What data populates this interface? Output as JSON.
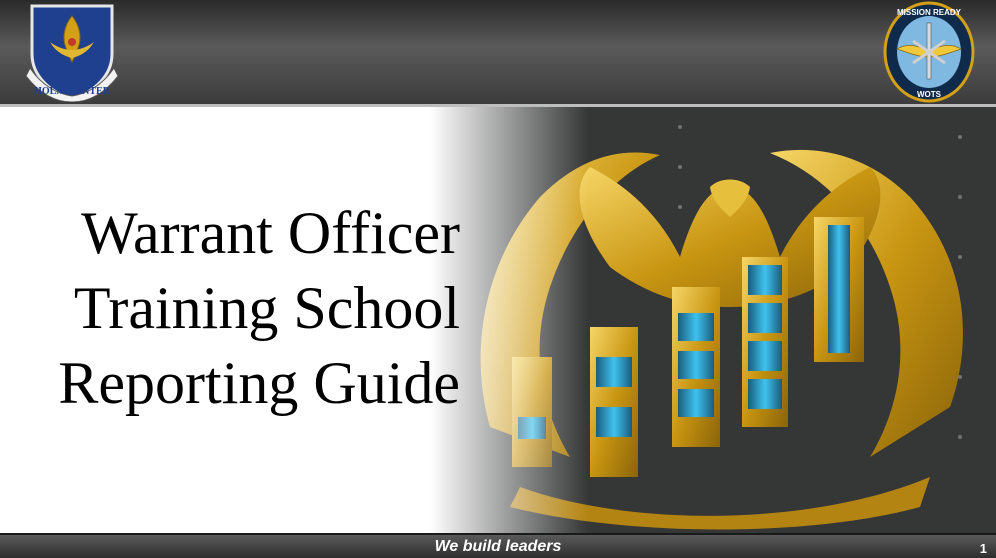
{
  "header": {
    "left_logo": {
      "icon": "holm-center-shield-icon",
      "text": "HOLM CENTER"
    },
    "right_logo": {
      "icon": "wots-mission-ready-patch-icon",
      "top_text": "MISSION READY",
      "bottom_text": "WOTS"
    }
  },
  "slide": {
    "title_lines": [
      "Warrant Officer",
      "Training School",
      "Reporting Guide"
    ],
    "image": {
      "icon": "warrant-officer-eagle-insignia-icon"
    }
  },
  "footer": {
    "tagline": "We build leaders",
    "page_number": "1"
  },
  "colors": {
    "bar_dark": "#2a2a2a",
    "shield_blue": "#1f3f8f",
    "gold": "#d4a017",
    "insignia_blue": "#2aa7d8"
  }
}
